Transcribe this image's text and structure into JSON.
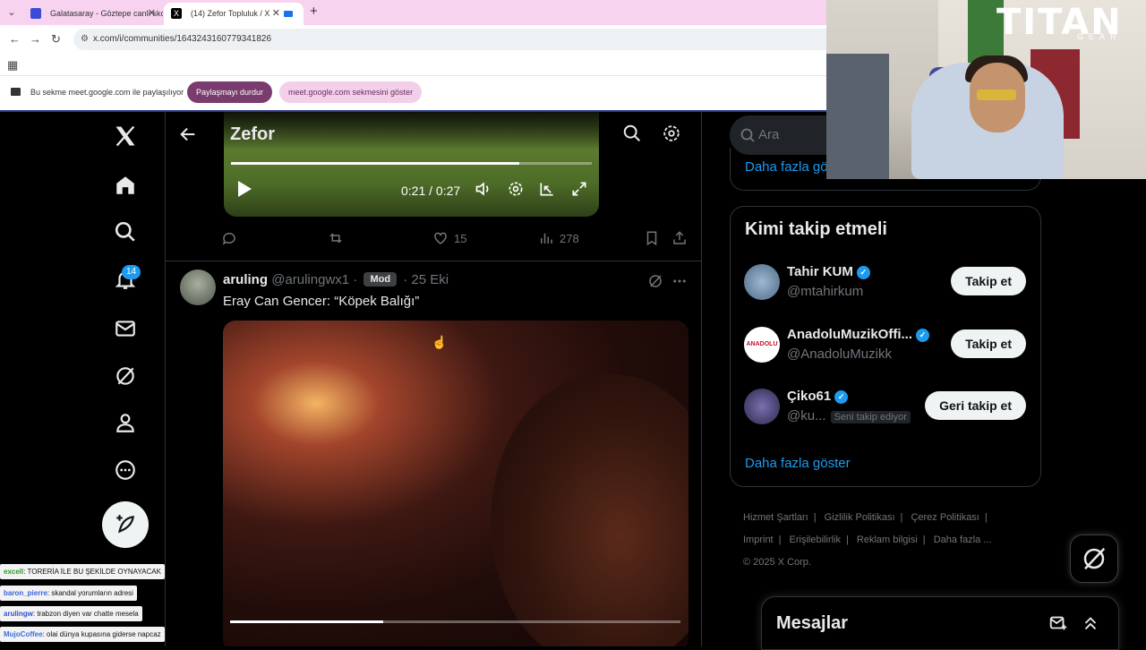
{
  "browser": {
    "tabs": [
      {
        "title": "Galatasaray - Göztepe canlı skor",
        "active": false
      },
      {
        "title": "(14) Zefor Topluluk / X",
        "active": true
      }
    ],
    "url": "x.com/i/communities/1643243160779341826",
    "share": {
      "text": "Bu sekme meet.google.com ile paylaşılıyor",
      "stop_label": "Paylaşmayı durdur",
      "show_label": "meet.google.com sekmesini göster"
    }
  },
  "nav": {
    "notifications_badge": "14"
  },
  "chat": [
    {
      "user": "excell",
      "msg": ": TORERİA İLE BU ŞEKİLDE OYNAYACAK"
    },
    {
      "user": "baron_pierre",
      "msg": ": skandal yorumların adresi"
    },
    {
      "user": "arulingw",
      "msg": ": trabzon diyen var chatte mesela"
    },
    {
      "user": "MujoCoffee",
      "msg": ": olai dünya kupasına gidersе napcaz"
    }
  ],
  "community": {
    "title": "Zefor"
  },
  "video1": {
    "time": "0:21 / 0:27",
    "progress": 0.8
  },
  "post1_actions": {
    "likes": "15",
    "views": "278"
  },
  "post2": {
    "name": "aruling",
    "handle": "@arulingwx1",
    "badge": "Mod",
    "time": "· 25 Eki",
    "text": "Eray Can Gencer: “Köpek Balığı”",
    "video_progress": 0.34
  },
  "sidebar": {
    "search_placeholder": "Ara",
    "top_card_more": "Daha fazla göster",
    "who_to_follow": {
      "title": "Kimi takip etmeli",
      "users": [
        {
          "name": "Tahir KUM",
          "handle": "@mtahirkum",
          "button": "Takip et",
          "follows_you": ""
        },
        {
          "name": "AnadoluMuzikOffi...",
          "handle": "@AnadoluMuzikk",
          "button": "Takip et",
          "follows_you": ""
        },
        {
          "name": "Çiko61",
          "handle": "@ku...",
          "button": "Geri takip et",
          "follows_you": "Seni takip ediyor"
        }
      ],
      "more": "Daha fazla göster"
    },
    "footer": {
      "links": [
        "Hizmet Şartları",
        "Gizlilik Politikası",
        "Çerez Politikası",
        "Imprint",
        "Erişilebilirlik",
        "Reklam bilgisi",
        "Daha fazla ..."
      ],
      "copyright": "© 2025 X Corp."
    },
    "messages_title": "Mesajlar"
  },
  "webcam": {
    "logo": "TITAN",
    "logo_sub": "GEAR"
  },
  "colors": {
    "accent": "#1d9bf0",
    "background": "#000000",
    "border": "#2f3336",
    "muted": "#71767b",
    "tabstrip": "#f7d3ef"
  }
}
